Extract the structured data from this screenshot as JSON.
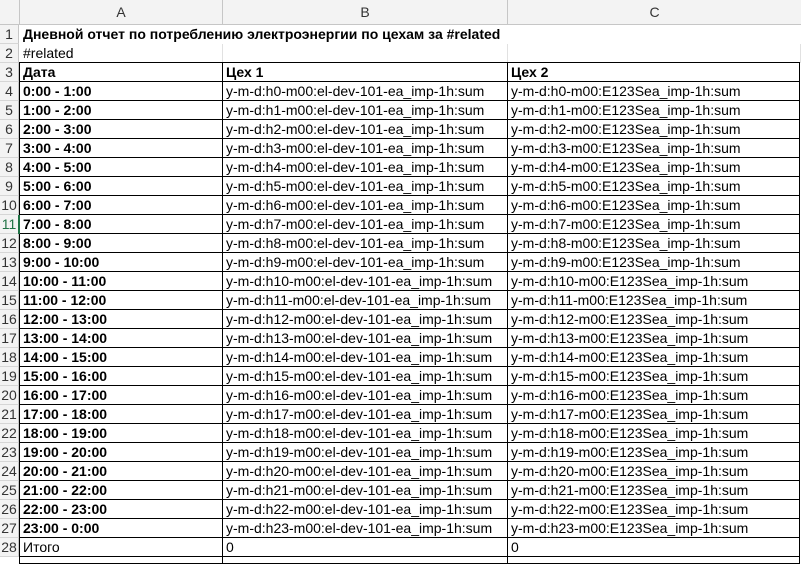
{
  "columns": [
    "A",
    "B",
    "C"
  ],
  "row_numbers": [
    "1",
    "2",
    "3",
    "4",
    "5",
    "6",
    "7",
    "8",
    "9",
    "10",
    "11",
    "12",
    "13",
    "14",
    "15",
    "16",
    "17",
    "18",
    "19",
    "20",
    "21",
    "22",
    "23",
    "24",
    "25",
    "26",
    "27",
    "28"
  ],
  "title": "Дневной отчет по потреблению электроэнергии по цехам за #related",
  "subtitle": "#related",
  "headers": [
    "Дата",
    "Цех 1",
    "Цех 2"
  ],
  "rows": [
    [
      "0:00 - 1:00",
      "y-m-d:h0-m00:el-dev-101-ea_imp-1h:sum",
      "y-m-d:h0-m00:E123Sea_imp-1h:sum"
    ],
    [
      "1:00 - 2:00",
      "y-m-d:h1-m00:el-dev-101-ea_imp-1h:sum",
      "y-m-d:h1-m00:E123Sea_imp-1h:sum"
    ],
    [
      "2:00 - 3:00",
      "y-m-d:h2-m00:el-dev-101-ea_imp-1h:sum",
      "y-m-d:h2-m00:E123Sea_imp-1h:sum"
    ],
    [
      "3:00 - 4:00",
      "y-m-d:h3-m00:el-dev-101-ea_imp-1h:sum",
      "y-m-d:h3-m00:E123Sea_imp-1h:sum"
    ],
    [
      "4:00 - 5:00",
      "y-m-d:h4-m00:el-dev-101-ea_imp-1h:sum",
      "y-m-d:h4-m00:E123Sea_imp-1h:sum"
    ],
    [
      "5:00 - 6:00",
      "y-m-d:h5-m00:el-dev-101-ea_imp-1h:sum",
      "y-m-d:h5-m00:E123Sea_imp-1h:sum"
    ],
    [
      "6:00 - 7:00",
      "y-m-d:h6-m00:el-dev-101-ea_imp-1h:sum",
      "y-m-d:h6-m00:E123Sea_imp-1h:sum"
    ],
    [
      "7:00 - 8:00",
      "y-m-d:h7-m00:el-dev-101-ea_imp-1h:sum",
      "y-m-d:h7-m00:E123Sea_imp-1h:sum"
    ],
    [
      "8:00 - 9:00",
      "y-m-d:h8-m00:el-dev-101-ea_imp-1h:sum",
      "y-m-d:h8-m00:E123Sea_imp-1h:sum"
    ],
    [
      "9:00 - 10:00",
      "y-m-d:h9-m00:el-dev-101-ea_imp-1h:sum",
      "y-m-d:h9-m00:E123Sea_imp-1h:sum"
    ],
    [
      "10:00 - 11:00",
      "y-m-d:h10-m00:el-dev-101-ea_imp-1h:sum",
      "y-m-d:h10-m00:E123Sea_imp-1h:sum"
    ],
    [
      "11:00 - 12:00",
      "y-m-d:h11-m00:el-dev-101-ea_imp-1h:sum",
      "y-m-d:h11-m00:E123Sea_imp-1h:sum"
    ],
    [
      "12:00 - 13:00",
      "y-m-d:h12-m00:el-dev-101-ea_imp-1h:sum",
      "y-m-d:h12-m00:E123Sea_imp-1h:sum"
    ],
    [
      "13:00 - 14:00",
      "y-m-d:h13-m00:el-dev-101-ea_imp-1h:sum",
      "y-m-d:h13-m00:E123Sea_imp-1h:sum"
    ],
    [
      "14:00 - 15:00",
      "y-m-d:h14-m00:el-dev-101-ea_imp-1h:sum",
      "y-m-d:h14-m00:E123Sea_imp-1h:sum"
    ],
    [
      "15:00 - 16:00",
      "y-m-d:h15-m00:el-dev-101-ea_imp-1h:sum",
      "y-m-d:h15-m00:E123Sea_imp-1h:sum"
    ],
    [
      "16:00 - 17:00",
      "y-m-d:h16-m00:el-dev-101-ea_imp-1h:sum",
      "y-m-d:h16-m00:E123Sea_imp-1h:sum"
    ],
    [
      "17:00 - 18:00",
      "y-m-d:h17-m00:el-dev-101-ea_imp-1h:sum",
      "y-m-d:h17-m00:E123Sea_imp-1h:sum"
    ],
    [
      "18:00 - 19:00",
      "y-m-d:h18-m00:el-dev-101-ea_imp-1h:sum",
      "y-m-d:h18-m00:E123Sea_imp-1h:sum"
    ],
    [
      "19:00 - 20:00",
      "y-m-d:h19-m00:el-dev-101-ea_imp-1h:sum",
      "y-m-d:h19-m00:E123Sea_imp-1h:sum"
    ],
    [
      "20:00 - 21:00",
      "y-m-d:h20-m00:el-dev-101-ea_imp-1h:sum",
      "y-m-d:h20-m00:E123Sea_imp-1h:sum"
    ],
    [
      "21:00 - 22:00",
      "y-m-d:h21-m00:el-dev-101-ea_imp-1h:sum",
      "y-m-d:h21-m00:E123Sea_imp-1h:sum"
    ],
    [
      "22:00 - 23:00",
      "y-m-d:h22-m00:el-dev-101-ea_imp-1h:sum",
      "y-m-d:h22-m00:E123Sea_imp-1h:sum"
    ],
    [
      "23:00 - 0:00",
      "y-m-d:h23-m00:el-dev-101-ea_imp-1h:sum",
      "y-m-d:h23-m00:E123Sea_imp-1h:sum"
    ]
  ],
  "total": [
    "Итого",
    "0",
    "0"
  ],
  "active_row": "11",
  "colors": {
    "header_bg": "#f3f3f3",
    "gridline": "#e1e1e1",
    "border": "#000000",
    "selection": "#217346"
  }
}
